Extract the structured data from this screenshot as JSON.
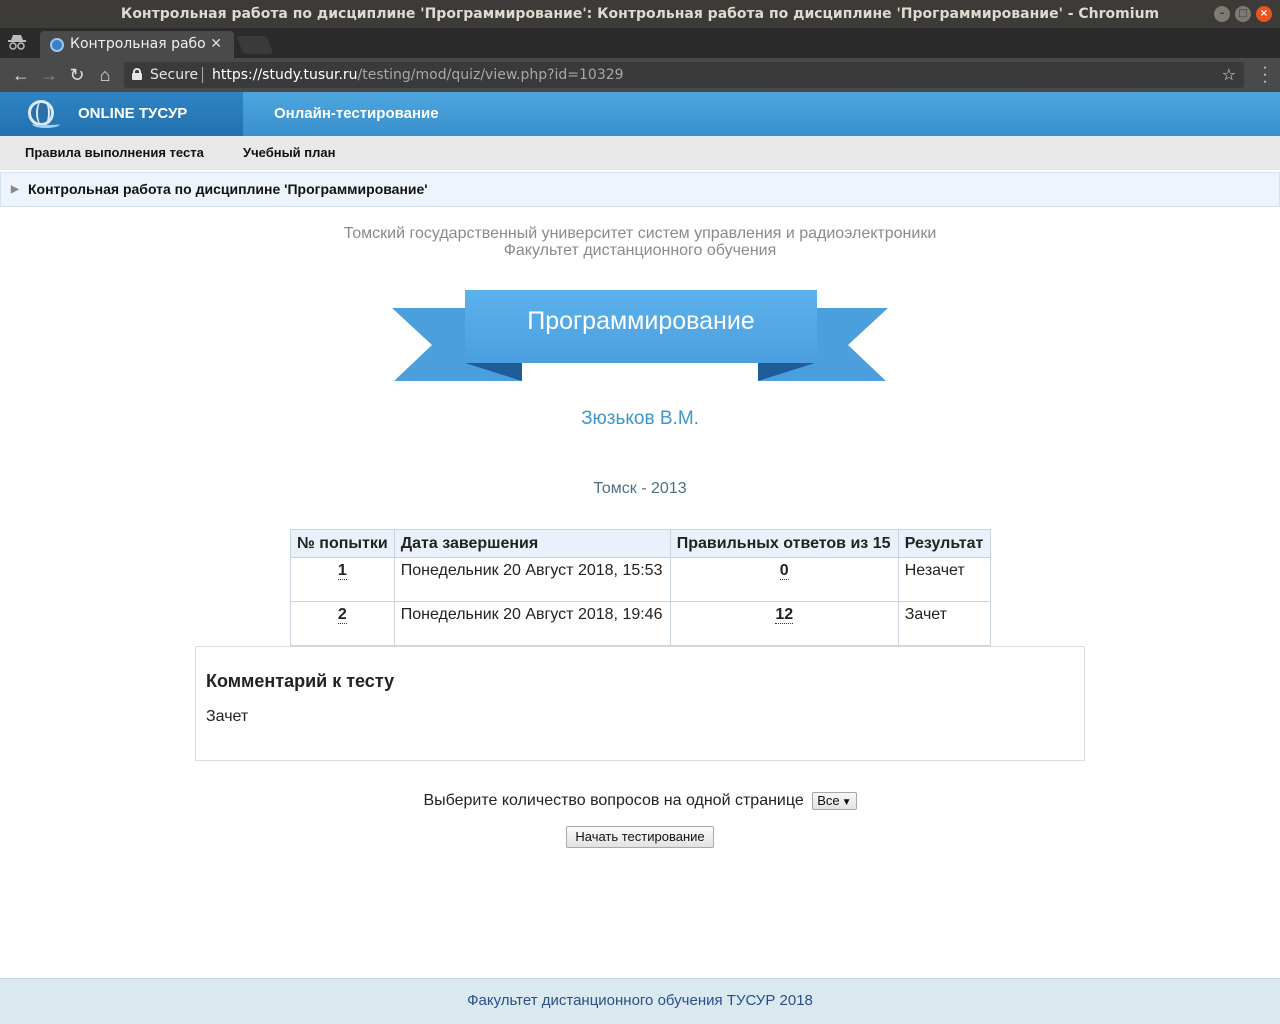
{
  "window": {
    "title": "Контрольная работа по дисциплине 'Программирование': Контрольная работа по дисциплине 'Программирование' - Chromium"
  },
  "tab": {
    "label": "Контрольная рабо"
  },
  "toolbar": {
    "secure_label": "Secure",
    "url_host": "https://study.tusur.ru",
    "url_path": "/testing/mod/quiz/view.php?id=10329"
  },
  "header": {
    "brand": "ONLINE ТУСУР",
    "nav_link": "Онлайн-тестирование"
  },
  "subnav": {
    "rules": "Правила выполнения теста",
    "plan": "Учебный план"
  },
  "breadcrumb": {
    "label": "Контрольная работа по дисциплине 'Программирование'"
  },
  "page": {
    "university": "Томский государственный университет систем управления и радиоэлектроники",
    "faculty": "Факультет дистанционного обучения",
    "subject": "Программирование",
    "author": "Зюзьков В.М.",
    "city_year": "Томск - 2013"
  },
  "attempts": {
    "headers": [
      "№ попытки",
      "Дата завершения",
      "Правильных ответов из 15",
      "Результат"
    ],
    "rows": [
      {
        "num": "1",
        "date": "Понедельник 20 Август 2018, 15:53",
        "correct": "0",
        "result": "Незачет"
      },
      {
        "num": "2",
        "date": "Понедельник 20 Август 2018, 19:46",
        "correct": "12",
        "result": "Зачет"
      }
    ]
  },
  "comment": {
    "title": "Комментарий к тесту",
    "text": "Зачет"
  },
  "perpage": {
    "label": "Выберите количество вопросов на одной странице",
    "selected": "Все"
  },
  "start_button": "Начать тестирование",
  "footer": "Факультет дистанционного обучения ТУСУР 2018",
  "colors": {
    "header_blue": "#3a8fcc",
    "brand_blue": "#2371ae",
    "ribbon_blue": "#5aaee8",
    "author_blue": "#3f96c9",
    "footer_bg": "#d9e9ef"
  }
}
